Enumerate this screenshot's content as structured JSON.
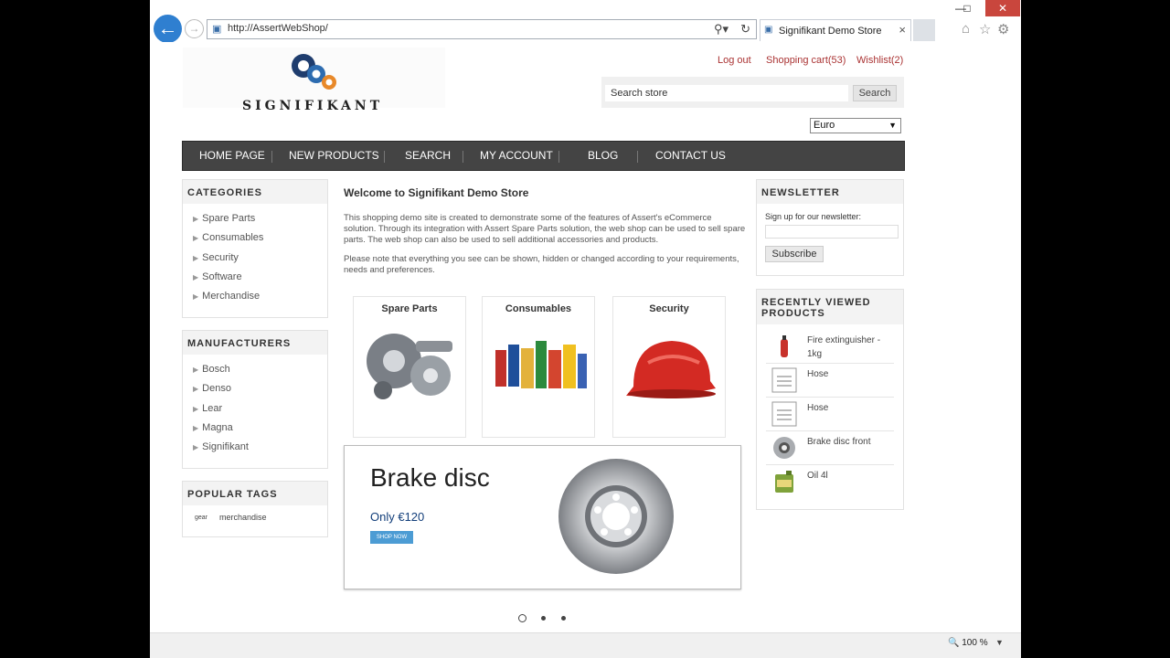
{
  "browser": {
    "address_url": "http://AssertWebShop/",
    "tab_title": "Signifikant Demo Store",
    "zoom": "100 %"
  },
  "header": {
    "logo_text": "SIGNIFIKANT",
    "logout": "Log out",
    "shopping_cart": "Shopping cart(53)",
    "wishlist": "Wishlist(2)",
    "search_placeholder": "Search store",
    "search_button": "Search",
    "currency": "Euro"
  },
  "nav": {
    "items": [
      "HOME PAGE",
      "NEW PRODUCTS",
      "SEARCH",
      "MY ACCOUNT",
      "BLOG",
      "CONTACT US"
    ]
  },
  "categories": {
    "title": "CATEGORIES",
    "items": [
      "Spare Parts",
      "Consumables",
      "Security",
      "Software",
      "Merchandise"
    ]
  },
  "manufacturers": {
    "title": "MANUFACTURERS",
    "items": [
      "Bosch",
      "Denso",
      "Lear",
      "Magna",
      "Signifikant"
    ]
  },
  "popular_tags": {
    "title": "POPULAR TAGS",
    "tags": [
      "gear",
      "merchandise"
    ]
  },
  "main": {
    "welcome_title": "Welcome to Signifikant Demo Store",
    "paragraph1": "This shopping demo site is created to demonstrate some of the features of Assert's eCommerce solution. Through its integration with Assert Spare Parts solution, the web shop can be used to sell spare parts. The web shop can also be used to sell additional accessories and products.",
    "paragraph2": "Please note that everything you see can be shown, hidden or changed according to your requirements, needs and preferences.",
    "category_cards": [
      "Spare Parts",
      "Consumables",
      "Security"
    ],
    "banner": {
      "title": "Brake disc",
      "price": "Only €120",
      "button": "SHOP NOW"
    }
  },
  "newsletter": {
    "title": "NEWSLETTER",
    "label": "Sign up for our newsletter:",
    "button": "Subscribe"
  },
  "recently_viewed": {
    "title": "RECENTLY VIEWED PRODUCTS",
    "items": [
      "Fire extinguisher - 1kg",
      "Hose",
      "Hose",
      "Brake disc front",
      "Oil 4l"
    ]
  }
}
